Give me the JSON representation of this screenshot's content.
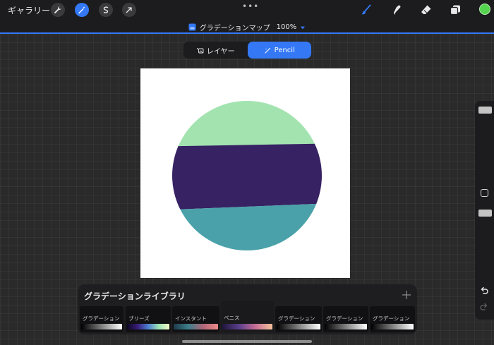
{
  "toolbar": {
    "gallery_label": "ギャラリー",
    "menu_dots": "•••",
    "left_tools": [
      {
        "icon": "wrench-icon"
      },
      {
        "icon": "magic-wand-icon",
        "active": true
      },
      {
        "icon": "selection-icon"
      },
      {
        "icon": "transform-arrow-icon"
      }
    ],
    "right_tools": [
      "brush-icon",
      "smudge-icon",
      "eraser-icon",
      "layers-icon"
    ],
    "current_color": "#55d24e"
  },
  "titlebar": {
    "adjustment": "グラデーションマップ",
    "zoom": "100%"
  },
  "mode_toggle": {
    "layer_label": "レイヤー",
    "pencil_label": "Pencil",
    "selected": "Pencil"
  },
  "canvas": {
    "bands": [
      {
        "name": "top-band",
        "color": "#a3e3b0"
      },
      {
        "name": "middle-band",
        "color": "#372263"
      },
      {
        "name": "bottom-band",
        "color": "#4aa1a9"
      }
    ]
  },
  "library": {
    "title": "グラデーションライブラリ",
    "add_icon": "plus-icon",
    "gradients": [
      {
        "label": "グラデーション",
        "stops": [
          "#000000",
          "#ffffff"
        ]
      },
      {
        "label": "ブリーズ",
        "stops": [
          "#0c0820",
          "#3a1d7a",
          "#4b7fd1",
          "#9ee3b5",
          "#f3f6c6"
        ]
      },
      {
        "label": "インスタント",
        "stops": [
          "#1e3a4a",
          "#3d7f8b",
          "#b06678",
          "#f08a8a"
        ]
      },
      {
        "label": "ベニス",
        "stops": [
          "#20163d",
          "#5a3f8a",
          "#c86e97",
          "#f4c29a"
        ],
        "selected": true
      },
      {
        "label": "グラデーション",
        "stops": [
          "#000000",
          "#ffffff"
        ]
      },
      {
        "label": "グラデーション",
        "stops": [
          "#000000",
          "#ffffff"
        ]
      },
      {
        "label": "グラデーション",
        "stops": [
          "#000000",
          "#ffffff"
        ]
      }
    ]
  },
  "sidebar": {
    "undo_icon": "undo-icon",
    "redo_icon": "redo-icon"
  }
}
